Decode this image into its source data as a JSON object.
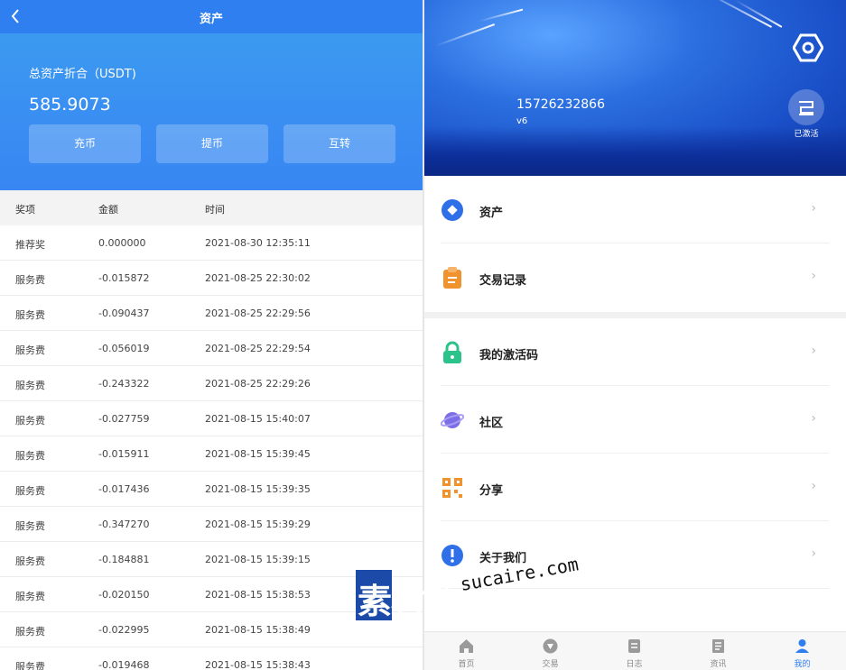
{
  "left": {
    "nav_title": "资产",
    "asset_label": "总资产折合（USDT)",
    "asset_value": "585.9073",
    "buttons": [
      "充币",
      "提币",
      "互转"
    ],
    "table": {
      "headers": [
        "奖项",
        "金额",
        "时间"
      ],
      "rows": [
        [
          "推荐奖",
          "0.000000",
          "2021-08-30 12:35:11"
        ],
        [
          "服务费",
          "-0.015872",
          "2021-08-25 22:30:02"
        ],
        [
          "服务费",
          "-0.090437",
          "2021-08-25 22:29:56"
        ],
        [
          "服务费",
          "-0.056019",
          "2021-08-25 22:29:54"
        ],
        [
          "服务费",
          "-0.243322",
          "2021-08-25 22:29:26"
        ],
        [
          "服务费",
          "-0.027759",
          "2021-08-15 15:40:07"
        ],
        [
          "服务费",
          "-0.015911",
          "2021-08-15 15:39:45"
        ],
        [
          "服务费",
          "-0.017436",
          "2021-08-15 15:39:35"
        ],
        [
          "服务费",
          "-0.347270",
          "2021-08-15 15:39:29"
        ],
        [
          "服务费",
          "-0.184881",
          "2021-08-15 15:39:15"
        ],
        [
          "服务费",
          "-0.020150",
          "2021-08-15 15:38:53"
        ],
        [
          "服务费",
          "-0.022995",
          "2021-08-15 15:38:49"
        ],
        [
          "服务费",
          "-0.019468",
          "2021-08-15 15:38:43"
        ]
      ]
    }
  },
  "right": {
    "phone": "15726232866",
    "level": "v6",
    "activated_label": "已激活",
    "menu": [
      {
        "label": "资产",
        "icon": "asset-icon"
      },
      {
        "label": "交易记录",
        "icon": "clipboard-icon"
      },
      {
        "label": "我的激活码",
        "icon": "lock-icon"
      },
      {
        "label": "社区",
        "icon": "planet-icon"
      },
      {
        "label": "分享",
        "icon": "qrcode-icon"
      },
      {
        "label": "关于我们",
        "icon": "info-icon"
      }
    ],
    "chevron": "›",
    "tabs": [
      {
        "label": "首页",
        "icon": "home-icon"
      },
      {
        "label": "交易",
        "icon": "trade-icon"
      },
      {
        "label": "日志",
        "icon": "log-icon"
      },
      {
        "label": "资讯",
        "icon": "news-icon"
      },
      {
        "label": "我的",
        "icon": "user-icon"
      }
    ],
    "active_tab": 4
  },
  "watermark": {
    "cn": "素材熱",
    "en": "sucaire.com"
  },
  "colors": {
    "accent": "#2f7ff0",
    "hero": "#3a8df2",
    "banner": "#1a4fc8"
  }
}
